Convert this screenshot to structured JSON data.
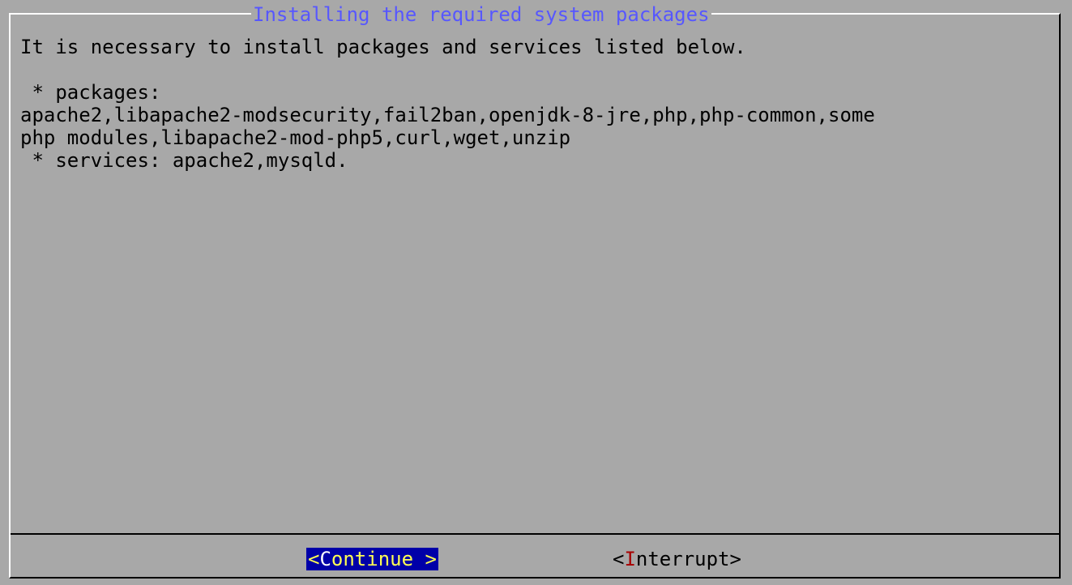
{
  "dialog": {
    "title": "Installing the required system packages",
    "lines": [
      "It is necessary to install packages and services listed below.",
      "",
      " * packages:",
      "apache2,libapache2-modsecurity,fail2ban,openjdk-8-jre,php,php-common,some",
      "php modules,libapache2-mod-php5,curl,wget,unzip",
      " * services: apache2,mysqld."
    ]
  },
  "buttons": {
    "continue": {
      "open": "<",
      "hotkey": "C",
      "rest": "ontinue >"
    },
    "interrupt": {
      "open": "<",
      "hotkey": "I",
      "rest": "nterrupt>"
    }
  },
  "colors": {
    "background": "#a8a8a8",
    "title": "#5757ff",
    "selected_button_bg": "#0000a8",
    "selected_button_fg": "#ffff54",
    "hotkey": "#a80000"
  }
}
